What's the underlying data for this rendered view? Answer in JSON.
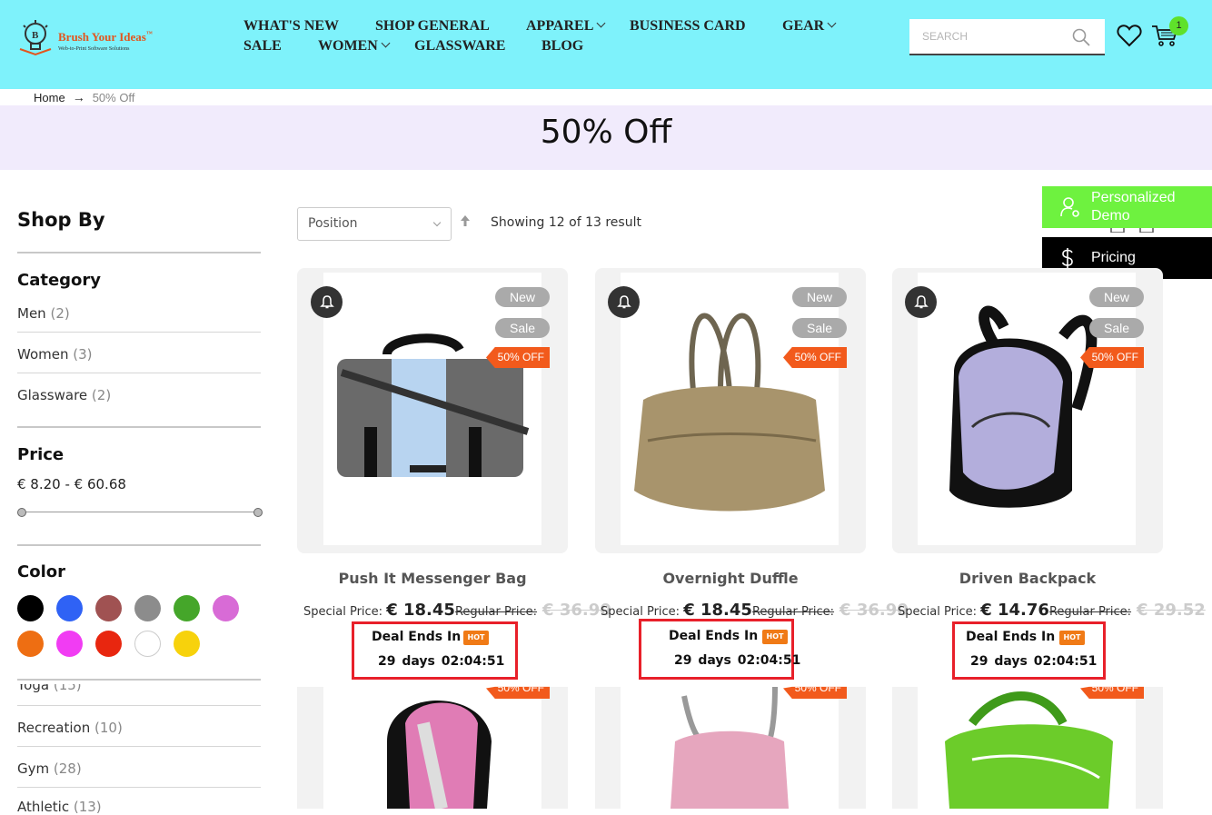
{
  "brand": {
    "name": "Brush Your Ideas",
    "tm": "™",
    "tagline": "Web-to-Print Software Solutions"
  },
  "nav": [
    {
      "label": "WHAT'S NEW",
      "has_dropdown": false
    },
    {
      "label": "SHOP GENERAL",
      "has_dropdown": false
    },
    {
      "label": "APPAREL",
      "has_dropdown": true
    },
    {
      "label": "BUSINESS CARD",
      "has_dropdown": false
    },
    {
      "label": "GEAR",
      "has_dropdown": true
    },
    {
      "label": "SALE",
      "has_dropdown": false
    },
    {
      "label": "WOMEN",
      "has_dropdown": true
    },
    {
      "label": "GLASSWARE",
      "has_dropdown": false
    },
    {
      "label": "BLOG",
      "has_dropdown": false
    }
  ],
  "search": {
    "placeholder": "SEARCH"
  },
  "cart": {
    "count": "1"
  },
  "breadcrumb": {
    "home": "Home",
    "arrow": "→",
    "current": "50% Off"
  },
  "page_title": "50% Off",
  "sidebar": {
    "heading": "Shop By",
    "category": {
      "title": "Category",
      "items": [
        {
          "label": "Men",
          "count": "(2)"
        },
        {
          "label": "Women",
          "count": "(3)"
        },
        {
          "label": "Glassware",
          "count": "(2)"
        }
      ]
    },
    "price": {
      "title": "Price",
      "range": "€ 8.20 - € 60.68"
    },
    "color": {
      "title": "Color",
      "swatches": [
        "#000000",
        "#2f62f5",
        "#a05252",
        "#8c8c8c",
        "#45a62a",
        "#d86bd6",
        "#ee6e12",
        "#f13cf3",
        "#e8260f",
        "#ffffff",
        "#f7d20c"
      ]
    },
    "activity": {
      "items": [
        {
          "label": "Yoga",
          "count": "(15)"
        },
        {
          "label": "Recreation",
          "count": "(10)"
        },
        {
          "label": "Gym",
          "count": "(28)"
        },
        {
          "label": "Athletic",
          "count": "(13)"
        }
      ]
    }
  },
  "toolbar": {
    "sort": "Position",
    "showing": "Showing 12 of 13 result"
  },
  "floaters": {
    "demo": "Personalized Demo",
    "pricing": "Pricing"
  },
  "products": [
    {
      "name": "Push It Messenger Bag",
      "special_label": "Special Price:",
      "special": "€ 18.45",
      "regular_label": "Regular Price:",
      "regular": "€ 36.90",
      "badge_new": "New",
      "badge_sale": "Sale",
      "off": "50% OFF",
      "deal_title": "Deal Ends In",
      "hot": "HOT",
      "deal_time": "29 days  02:04:51"
    },
    {
      "name": "Overnight Duffle",
      "special_label": "Special Price:",
      "special": "€ 18.45",
      "regular_label": "Regular Price:",
      "regular": "€ 36.90",
      "badge_new": "New",
      "badge_sale": "Sale",
      "off": "50% OFF",
      "deal_title": "Deal Ends In",
      "hot": "HOT",
      "deal_time": "29 days  02:04:51"
    },
    {
      "name": "Driven Backpack",
      "special_label": "Special Price:",
      "special": "€ 14.76",
      "regular_label": "Regular Price:",
      "regular": "€ 29.52",
      "badge_new": "New",
      "badge_sale": "Sale",
      "off": "50% OFF",
      "deal_title": "Deal Ends In",
      "hot": "HOT",
      "deal_time": "29 days  02:04:51"
    }
  ],
  "products_row2": [
    {
      "off": "50% OFF"
    },
    {
      "off": "50% OFF"
    },
    {
      "off": "50% OFF"
    }
  ]
}
